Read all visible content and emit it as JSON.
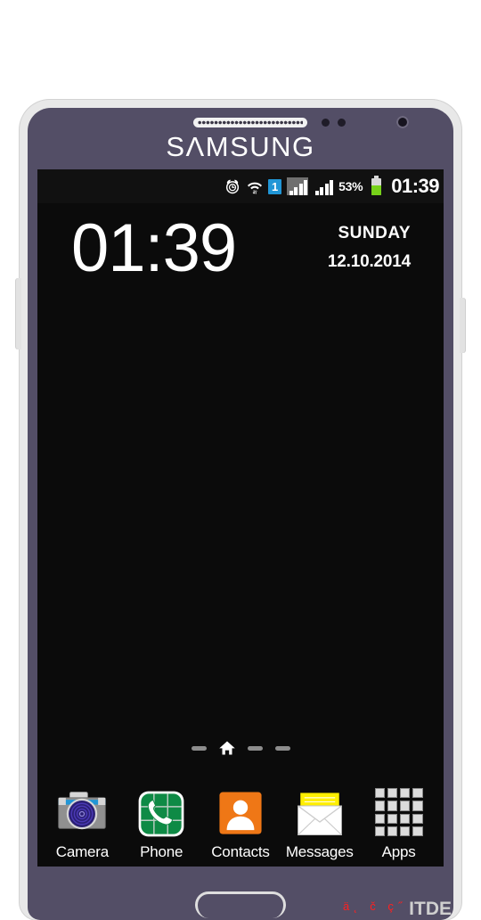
{
  "device": {
    "brand": "SAMSUNG",
    "brand_glyph_a": "Λ",
    "bezel_color": "#534e66",
    "frame_color": "#e8e8e8",
    "screen_bg": "#0b0b0b",
    "hardware": {
      "earpiece": "earpiece-speaker",
      "front_camera": "front-camera",
      "sensors": "proximity-sensors",
      "home_button": "home-button",
      "volume_button": "volume-button",
      "power_button": "power-button"
    }
  },
  "status_bar": {
    "background": "#111111",
    "alarm_icon": "alarm-clock-icon",
    "wifi_icon": "wifi-icon",
    "sim_badge": "1",
    "sim_badge_color": "#2196d6",
    "signal_1_icon": "signal-bars-icon",
    "signal_2_icon": "signal-bars-icon",
    "battery_percent": "53%",
    "battery_level": 53,
    "battery_color": "#76d119",
    "battery_icon": "battery-icon",
    "clock": "01:39"
  },
  "clock_widget": {
    "time": "01:39",
    "weekday": "SUNDAY",
    "date": "12.10.2014"
  },
  "home": {
    "page_indicator": {
      "pages": 4,
      "current_page_icon": "home-page-icon",
      "current_index": 1
    }
  },
  "dock": {
    "items": [
      {
        "label": "Camera",
        "icon": "camera-icon"
      },
      {
        "label": "Phone",
        "icon": "phone-handset-icon"
      },
      {
        "label": "Contacts",
        "icon": "contacts-person-icon"
      },
      {
        "label": "Messages",
        "icon": "messages-envelope-icon"
      },
      {
        "label": "Apps",
        "icon": "apps-grid-icon"
      }
    ]
  },
  "watermark": {
    "text": "ä˛  č  ç˝",
    "logo": "ITDE",
    "text_color": "#ff2020",
    "logo_color": "#cfcfcf"
  }
}
